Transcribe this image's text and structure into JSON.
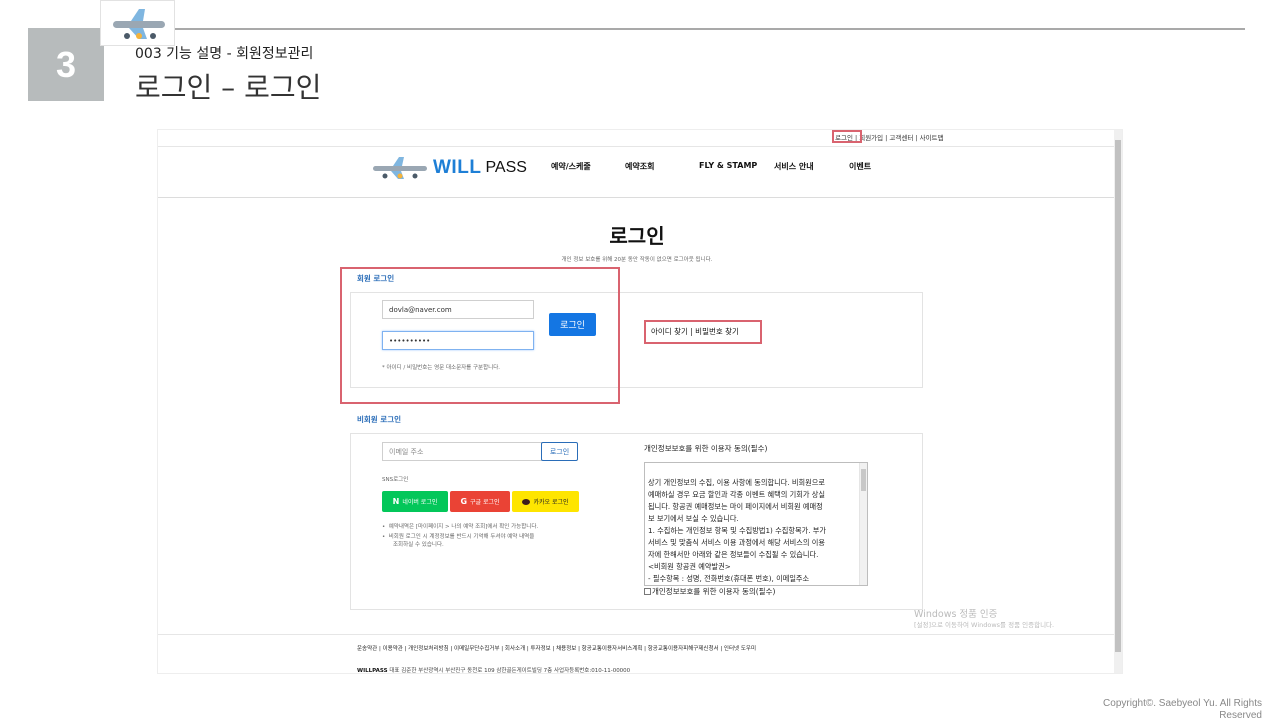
{
  "slide": {
    "number": "3",
    "subtitle": "003 기능 설명 - 회원정보관리",
    "title": "로그인 – 로그인",
    "copyright_line1": "Copyright©. Saebyeol Yu. All Rights",
    "copyright_line2": "Reserved"
  },
  "site": {
    "util_links": [
      "로그인",
      "회원가입",
      "고객센터",
      "사이트맵"
    ],
    "brand": {
      "name": "WILL",
      "suffix": "PASS"
    },
    "nav": [
      "예약/스케줄",
      "예약조회",
      "FLY & STAMP",
      "서비스 안내",
      "이벤트"
    ],
    "login": {
      "heading": "로그인",
      "notice": "개인 정보 보호를 위해 20분 동안 작동이 없으면 로그아웃 됩니다.",
      "member_label": "회원 로그인",
      "id_value": "dovla@naver.com",
      "password_value": "••••••••••",
      "login_button": "로그인",
      "case_note": "* 아이디 / 비밀번호는 영문 대소문자를 구분합니다.",
      "find_links": "아이디 찾기 | 비밀번호 찾기"
    },
    "guest": {
      "label": "비회원 로그인",
      "email_placeholder": "이메일 주소",
      "login_button": "로그인",
      "sns_label": "SNS로그인",
      "naver": "네이버 로그인",
      "google": "구글 로그인",
      "kakao": "카카오 로그인",
      "bullet1": "예약내역은 [마이페이지 > 나의 예약 조회]에서 확인 가능합니다.",
      "bullet2a": "비회원 로그인 시 계정정보를 반드시 기억해 두셔야 예약 내역을",
      "bullet2b": "조회하실 수 있습니다."
    },
    "agreement": {
      "title": "개인정보보호를 위한 이용자 동의(필수)",
      "text": [
        "",
        "상기 개인정보의 수집, 이용 사항에 동의합니다. 비회원으로",
        "예매하실 경우 요금 할인과 각종 이벤트 혜택의 기회가 상실",
        "됩니다. 항공권 예매정보는 마이 페이지에서 비회원 예매정",
        "보 보기에서 보실 수 있습니다.",
        "1. 수집하는 개인정보 항목 및 수집방법1) 수집항목가. 부가",
        "서비스 및 맞춤식 서비스 이용 과정에서 해당 서비스의 이용",
        "자에 한해서만 아래와 같은 정보들이 수집될 수 있습니다.",
        "<비회원 항공권 예약발권>",
        "- 필수항목 : 성명, 전화번호(휴대폰 번호), 이메일주소"
      ],
      "checkbox_label": "개인정보보호를 위한 이용자 동의(필수)"
    },
    "windows": {
      "line1": "Windows 정품 인증",
      "line2": "[설정]으로 이동하여 Windows를 정품 인증합니다."
    },
    "footer": {
      "links": "운송약관 | 이용약관 | 개인정보처리방침 | 이메일무단수집거부 | 회사소개 | 투자정보 | 채용정보 | 항공교통이용자서비스계획 | 항공교통이용자피해구제신청서 | 인터넷 도우미",
      "company": "WILLPASS",
      "address": "대표 김준한 부산광역시 부산진구 동천로 109 삼한골든게이트빌딩 7층 사업자등록번호:010-11-00000"
    }
  },
  "colors": {
    "highlight": "#d9636f",
    "primary": "#1476e3",
    "naver": "#03c75a",
    "google": "#ea4335",
    "kakao": "#fee500"
  }
}
